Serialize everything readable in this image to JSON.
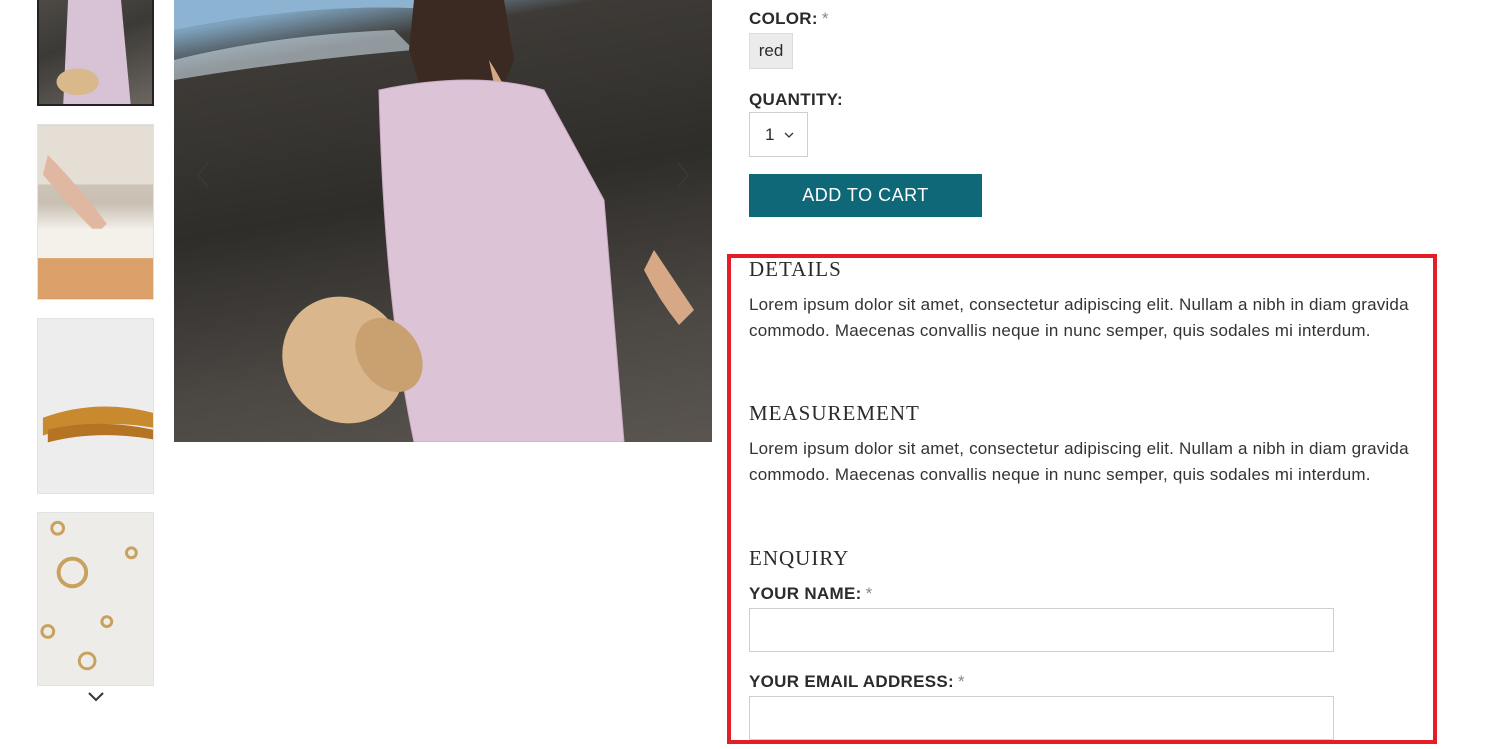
{
  "options": {
    "color_label": "COLOR:",
    "required_mark": "*",
    "color_value": "red",
    "quantity_label": "QUANTITY:",
    "quantity_value": "1",
    "add_to_cart": "ADD TO CART"
  },
  "details": {
    "title": "DETAILS",
    "text": "Lorem ipsum dolor sit amet, consectetur adipiscing elit. Nullam a nibh in diam gravida commodo. Maecenas convallis neque in nunc semper, quis sodales mi interdum."
  },
  "measurement": {
    "title": "MEASUREMENT",
    "text": "Lorem ipsum dolor sit amet, consectetur adipiscing elit. Nullam a nibh in diam gravida commodo. Maecenas convallis neque in nunc semper, quis sodales mi interdum."
  },
  "enquiry": {
    "title": "ENQUIRY",
    "name_label": "YOUR NAME:",
    "email_label": "YOUR EMAIL ADDRESS:",
    "name_value": "",
    "email_value": ""
  },
  "colors": {
    "accent_button": "#0e6877",
    "highlight_border": "#e41e26"
  }
}
